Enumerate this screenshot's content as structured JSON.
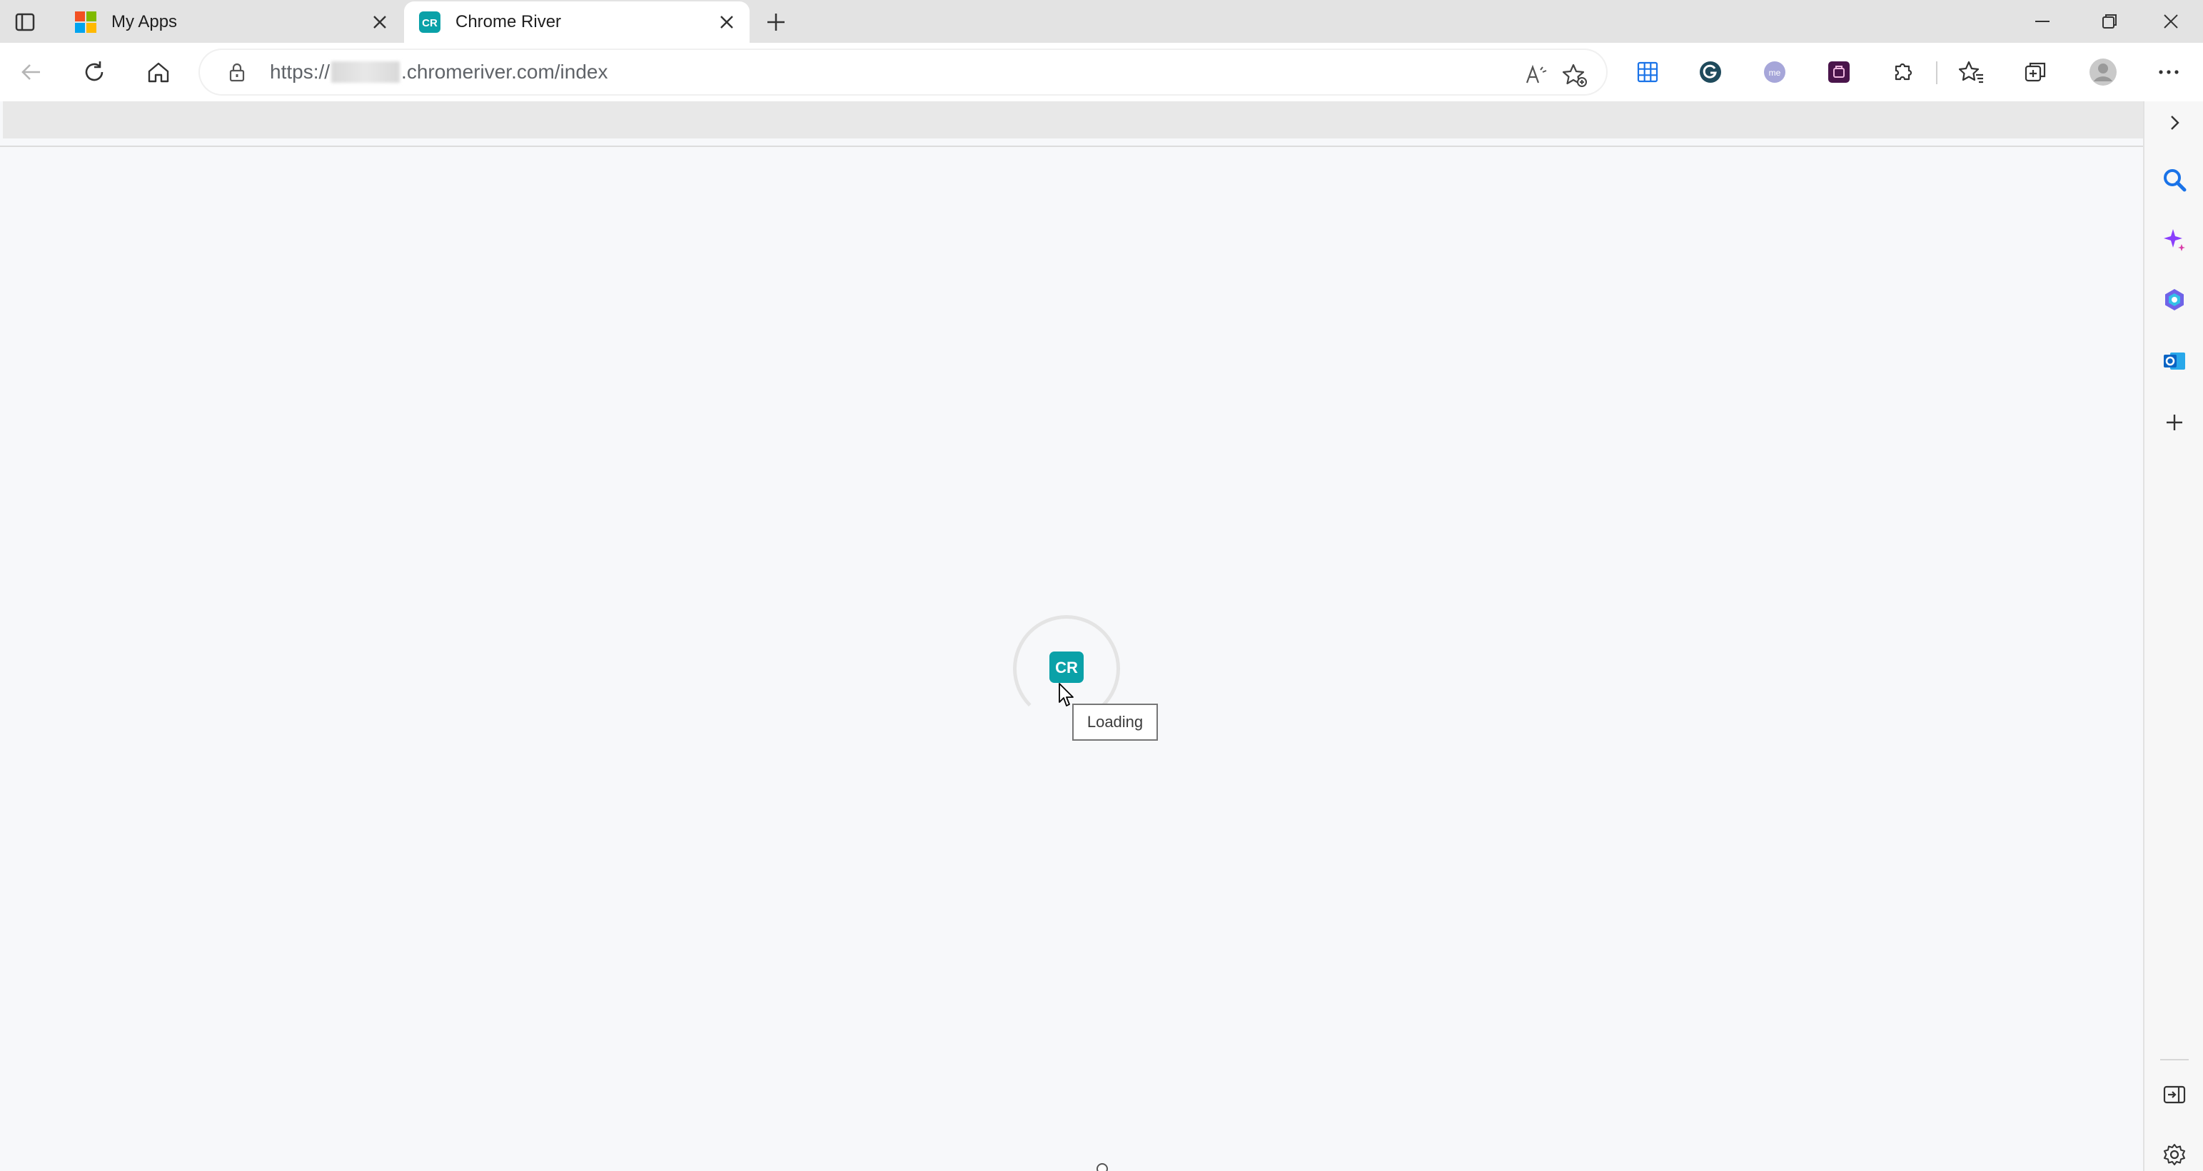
{
  "tabs": [
    {
      "title": "My Apps",
      "favicon": "microsoft-logo-icon",
      "active": false
    },
    {
      "title": "Chrome River",
      "favicon": "chrome-river-logo-icon",
      "active": true
    }
  ],
  "address_bar": {
    "scheme": "https://",
    "host_suffix": ".chromeriver.com/index"
  },
  "page": {
    "loading_tooltip": "Loading",
    "logo_text": "CR"
  },
  "icons": {
    "tab_actions": "tab-actions-icon",
    "back": "back-arrow-icon",
    "refresh": "refresh-icon",
    "home": "home-icon",
    "lock": "lock-icon",
    "read_aloud": "read-aloud-icon",
    "add_favorite": "add-favorite-icon",
    "extensions": "extensions-icon",
    "favorites": "favorites-icon",
    "collections": "collections-icon",
    "profile": "profile-avatar-icon",
    "more": "more-icon",
    "sidebar_search": "search-icon",
    "sidebar_copilot": "copilot-icon",
    "sidebar_m365": "microsoft-365-icon",
    "sidebar_outlook": "outlook-icon",
    "sidebar_add": "add-icon",
    "sidebar_hide": "hide-sidebar-icon",
    "sidebar_settings": "gear-icon"
  },
  "colors": {
    "chrome_river_teal": "#0aa1a8",
    "tab_strip": "#e3e3e3",
    "content_bg": "#f7f8fa"
  }
}
